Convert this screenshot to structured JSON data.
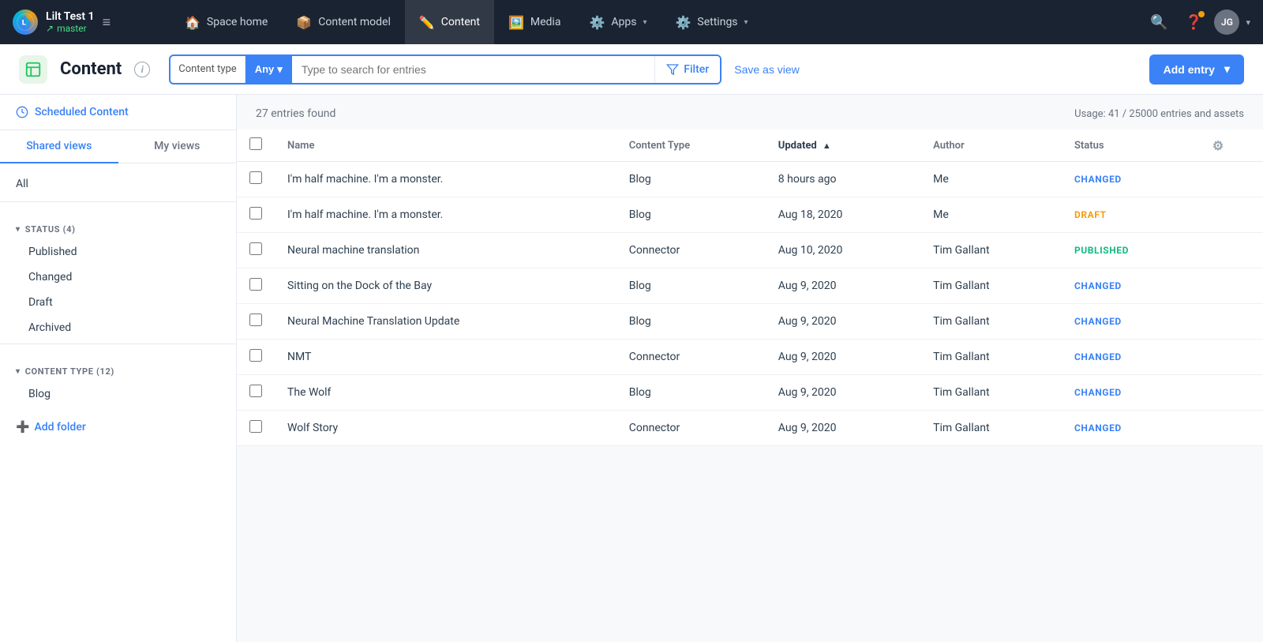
{
  "app": {
    "name": "Lilt Test 1",
    "branch": "master",
    "logo_letter": "L"
  },
  "topnav": {
    "links": [
      {
        "id": "space-home",
        "icon": "🏠",
        "label": "Space home",
        "active": false
      },
      {
        "id": "content-model",
        "icon": "📦",
        "label": "Content model",
        "active": false
      },
      {
        "id": "content",
        "icon": "✏️",
        "label": "Content",
        "active": true
      },
      {
        "id": "media",
        "icon": "🖼️",
        "label": "Media",
        "active": false
      },
      {
        "id": "apps",
        "icon": "⚙️",
        "label": "Apps",
        "active": false,
        "arrow": true
      },
      {
        "id": "settings",
        "icon": "⚙️",
        "label": "Settings",
        "active": false,
        "arrow": true
      }
    ],
    "user_initials": "JG"
  },
  "subheader": {
    "page_title": "Content",
    "search_placeholder": "Type to search for entries",
    "content_type_label": "Content type",
    "content_type_value": "Any",
    "filter_label": "Filter",
    "save_as_view_label": "Save as view",
    "add_entry_label": "Add entry"
  },
  "sidebar": {
    "scheduled_content_label": "Scheduled Content",
    "tabs": [
      {
        "id": "shared",
        "label": "Shared views",
        "active": true
      },
      {
        "id": "my",
        "label": "My views",
        "active": false
      }
    ],
    "all_label": "All",
    "status_group": {
      "label": "STATUS (4)",
      "items": [
        "Published",
        "Changed",
        "Draft",
        "Archived"
      ]
    },
    "content_type_group": {
      "label": "CONTENT TYPE (12)",
      "items": [
        "Blog"
      ]
    },
    "add_folder_label": "Add folder"
  },
  "content_list": {
    "entries_found": "27 entries found",
    "usage": "Usage: 41 / 25000 entries and assets",
    "columns": {
      "name": "Name",
      "content_type": "Content Type",
      "updated": "Updated",
      "author": "Author",
      "status": "Status"
    },
    "entries": [
      {
        "id": 1,
        "name": "I'm half machine. I'm a monster.",
        "content_type": "Blog",
        "updated": "8 hours ago",
        "author": "Me",
        "status": "CHANGED",
        "status_class": "status-changed"
      },
      {
        "id": 2,
        "name": "I'm half machine. I'm a monster.",
        "content_type": "Blog",
        "updated": "Aug 18, 2020",
        "author": "Me",
        "status": "DRAFT",
        "status_class": "status-draft"
      },
      {
        "id": 3,
        "name": "Neural machine translation",
        "content_type": "Connector",
        "updated": "Aug 10, 2020",
        "author": "Tim Gallant",
        "status": "PUBLISHED",
        "status_class": "status-published"
      },
      {
        "id": 4,
        "name": "Sitting on the Dock of the Bay",
        "content_type": "Blog",
        "updated": "Aug 9, 2020",
        "author": "Tim Gallant",
        "status": "CHANGED",
        "status_class": "status-changed"
      },
      {
        "id": 5,
        "name": "Neural Machine Translation Update",
        "content_type": "Blog",
        "updated": "Aug 9, 2020",
        "author": "Tim Gallant",
        "status": "CHANGED",
        "status_class": "status-changed"
      },
      {
        "id": 6,
        "name": "NMT",
        "content_type": "Connector",
        "updated": "Aug 9, 2020",
        "author": "Tim Gallant",
        "status": "CHANGED",
        "status_class": "status-changed"
      },
      {
        "id": 7,
        "name": "The Wolf",
        "content_type": "Blog",
        "updated": "Aug 9, 2020",
        "author": "Tim Gallant",
        "status": "CHANGED",
        "status_class": "status-changed"
      },
      {
        "id": 8,
        "name": "Wolf Story",
        "content_type": "Connector",
        "updated": "Aug 9, 2020",
        "author": "Tim Gallant",
        "status": "CHANGED",
        "status_class": "status-changed"
      }
    ]
  }
}
